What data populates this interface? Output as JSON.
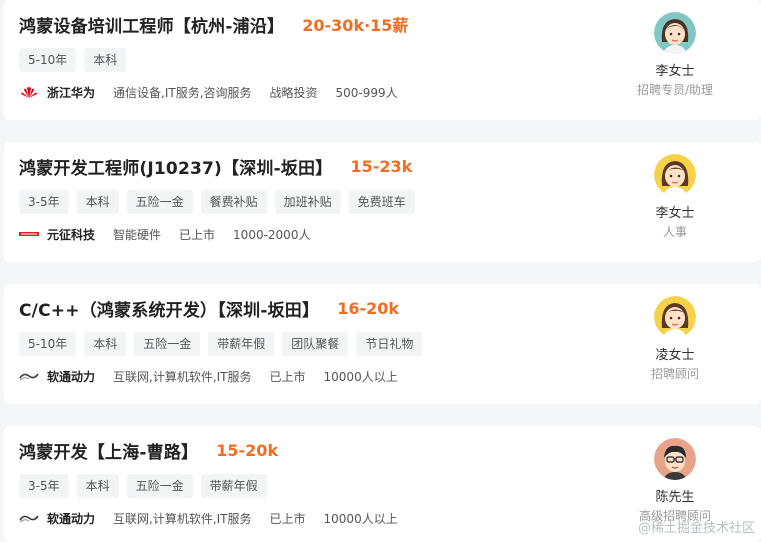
{
  "jobs": [
    {
      "title": "鸿蒙设备培训工程师【杭州-浦沿】",
      "salary": "20-30k·15薪",
      "tags": [
        "5-10年",
        "本科"
      ],
      "company": "浙江华为",
      "company_meta": [
        "通信设备,IT服务,咨询服务",
        "战略投资",
        "500-999人"
      ],
      "recruiter_name": "李女士",
      "recruiter_role": "招聘专员/助理",
      "logo_icon": "huawei-logo"
    },
    {
      "title": "鸿蒙开发工程师(J10237)【深圳-坂田】",
      "salary": "15-23k",
      "tags": [
        "3-5年",
        "本科",
        "五险一金",
        "餐费补贴",
        "加班补贴",
        "免费班车"
      ],
      "company": "元征科技",
      "company_meta": [
        "智能硬件",
        "已上市",
        "1000-2000人"
      ],
      "recruiter_name": "李女士",
      "recruiter_role": "人事",
      "logo_icon": "launch-logo"
    },
    {
      "title": "C/C++（鸿蒙系统开发）【深圳-坂田】",
      "salary": "16-20k",
      "tags": [
        "5-10年",
        "本科",
        "五险一金",
        "带薪年假",
        "团队聚餐",
        "节日礼物"
      ],
      "company": "软通动力",
      "company_meta": [
        "互联网,计算机软件,IT服务",
        "已上市",
        "10000人以上"
      ],
      "recruiter_name": "凌女士",
      "recruiter_role": "招聘顾问",
      "logo_icon": "isoftstone-logo"
    },
    {
      "title": "鸿蒙开发【上海-曹路】",
      "salary": "15-20k",
      "tags": [
        "3-5年",
        "本科",
        "五险一金",
        "带薪年假"
      ],
      "company": "软通动力",
      "company_meta": [
        "互联网,计算机软件,IT服务",
        "已上市",
        "10000人以上"
      ],
      "recruiter_name": "陈先生",
      "recruiter_role": "高级招聘顾问",
      "logo_icon": "isoftstone-logo"
    }
  ],
  "watermark": "@稀土掘金技术社区",
  "colors": {
    "salary": "#f26d21",
    "background": "#f5f6f8"
  }
}
